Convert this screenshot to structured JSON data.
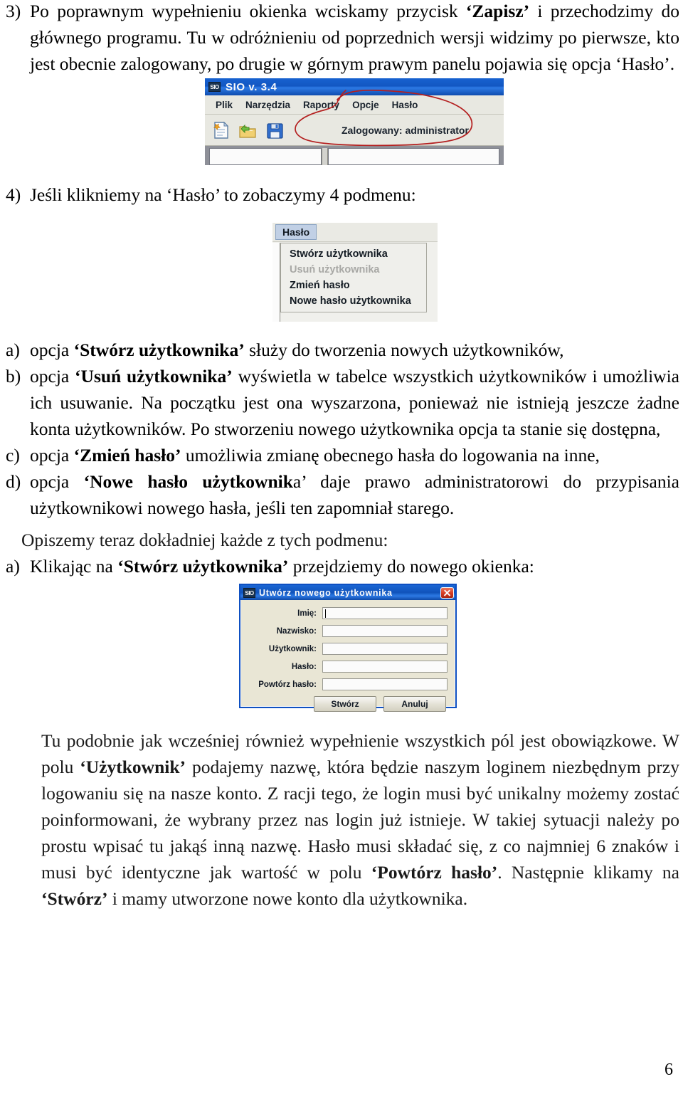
{
  "document": {
    "page_number": "6",
    "paragraphs": {
      "intro_marker": "3)",
      "intro_line1_a": "Po poprawnym wypełnieniu okienka wciskamy przycisk ",
      "intro_bold1": "‘Zapisz’",
      "intro_line1_b": " i przechodzimy do głównego programu. Tu w odróżnieniu od poprzednich wersji widzimy po pierwsze, kto jest obecnie zalogowany, po drugie w górnym prawym panelu pojawia się opcja ‘Hasło’.",
      "q4_marker": "4)",
      "q4_text": "Jeśli klikniemy na ‘Hasło’ to zobaczymy 4 podmenu:",
      "a_marker": "a)",
      "a_pre": "opcja ",
      "a_bold": "‘Stwórz użytkownika’",
      "a_post": " służy do tworzenia nowych użytkowników,",
      "b_marker": "b)",
      "b_pre": "opcja ",
      "b_bold": "‘Usuń użytkownika’",
      "b_post": " wyświetla w tabelce wszystkich użytkowników i umożliwia ich usuwanie. Na początku jest ona wyszarzona, ponieważ nie istnieją jeszcze żadne konta użytkowników. Po stworzeniu nowego użytkownika opcja ta stanie się dostępna,",
      "c_marker": "c)",
      "c_pre": "opcja ",
      "c_bold": "‘Zmień hasło’",
      "c_post": " umożliwia zmianę obecnego hasła do logowania na inne,",
      "d_marker": "d)",
      "d_pre": "opcja ",
      "d_bold": "‘Nowe hasło użytkownik",
      "d_post": "a’ daje prawo administratorowi do przypisania użytkownikowi nowego hasła, jeśli ten zapomniał starego.",
      "opiszemy": "Opiszemy teraz dokładniej każde z tych podmenu:",
      "a2_marker": "a)",
      "a2_pre": "Klikając na ",
      "a2_bold": "‘Stwórz użytkownika’",
      "a2_post": " przejdziemy do nowego okienka:",
      "final_pre1": "Tu podobnie jak wcześniej również wypełnienie wszystkich pól jest obowiązkowe. W polu ",
      "final_bold1": "‘Użytkownik’",
      "final_mid1": " podajemy nazwę, która będzie naszym loginem niezbędnym przy logowaniu się na nasze konto. Z racji tego, że login musi być unikalny możemy zostać poinformowani, że wybrany przez nas login już istnieje. W takiej sytuacji należy po prostu wpisać tu jakąś inną nazwę. Hasło musi składać się, z co najmniej 6 znaków i musi być identyczne jak wartość w polu ",
      "final_bold2": "‘Powtórz hasło’",
      "final_mid2": ". Następnie klikamy na ",
      "final_bold3": "‘Stwórz’",
      "final_post": " i mamy utworzone nowe konto dla użytkownika."
    }
  },
  "sio_window": {
    "app_badge": "SIO",
    "title": "SIO v. 3.4",
    "menu": [
      {
        "label": "Plik"
      },
      {
        "label": "Narzędzia"
      },
      {
        "label": "Raporty"
      },
      {
        "label": "Opcje"
      },
      {
        "label": "Hasło"
      }
    ],
    "toolbar_icons": [
      {
        "name": "new-document-icon"
      },
      {
        "name": "open-folder-icon"
      },
      {
        "name": "save-icon"
      }
    ],
    "logged_in_text": "Zalogowany: administrator",
    "annotation_color": "#b42020",
    "titlebar_color": "#0f55c4"
  },
  "menu_screenshot": {
    "active_menu": "Hasło",
    "items": [
      {
        "label": "Stwórz użytkownika",
        "disabled": false
      },
      {
        "label": "Usuń użytkownika",
        "disabled": true
      },
      {
        "label": "Zmień hasło",
        "disabled": false
      },
      {
        "label": "Nowe hasło użytkownika",
        "disabled": false
      }
    ],
    "highlight_color": "#c3d3e8",
    "disabled_color": "#a9a9a6"
  },
  "dialog": {
    "app_badge": "SIO",
    "title": "Utwórz nowego użytkownika",
    "close_label": "×",
    "fields": [
      {
        "label": "Imię:",
        "value": "",
        "focused": true
      },
      {
        "label": "Nazwisko:",
        "value": "",
        "focused": false
      },
      {
        "label": "Użytkownik:",
        "value": "",
        "focused": false
      },
      {
        "label": "Hasło:",
        "value": "",
        "focused": false
      },
      {
        "label": "Powtórz hasło:",
        "value": "",
        "focused": false
      }
    ],
    "buttons": [
      {
        "label": "Stwórz"
      },
      {
        "label": "Anuluj"
      }
    ],
    "titlebar_color": "#0d52bd",
    "close_color": "#d8391e"
  }
}
